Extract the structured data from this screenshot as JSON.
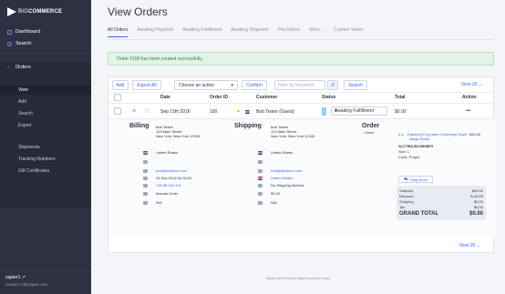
{
  "sidebar": {
    "logo_prefix": "BIG",
    "logo_suffix": "COMMERCE",
    "dashboard": "Dashboard",
    "search": "Search",
    "orders": "Orders",
    "sub_items": [
      "View",
      "Add",
      "Search",
      "Export",
      "Shipments",
      "Tracking Numbers",
      "Gift Certificates"
    ],
    "username": "zapier1",
    "email": "contact+1@zapier.com"
  },
  "header": {
    "title": "View Orders",
    "tabs": [
      "All Orders",
      "Awaiting Payment",
      "Awaiting Fulfillment",
      "Awaiting Shipment",
      "Pre-Orders",
      "More ⌄",
      "Custom Views"
    ]
  },
  "alert": "Order #100 has been created successfully.",
  "toolbar": {
    "add": "Add",
    "export_all": "Export All",
    "action_select": "Choose an action",
    "confirm": "Confirm",
    "filter_placeholder": "Filter by Keyword",
    "search": "Search",
    "view_count": "View 20 ⌄"
  },
  "table": {
    "headers": [
      "Date",
      "Order ID",
      "Customer",
      "Status",
      "Total",
      "Action"
    ],
    "row": {
      "date": "Sep 15th 2016",
      "order_id": "100",
      "customer": "Bob Tester (Guest)",
      "status": "Awaiting Fulfillment",
      "total": "$0.00",
      "action": "•••"
    }
  },
  "billing": {
    "title": "Billing",
    "name": "Bob Tester",
    "street": "123 Main Street",
    "city": "New York, New York 12345",
    "country": "United States",
    "email": "bob@techinch.com",
    "date": "15 Sep 2016 04:30:32",
    "ip": "135.95.242.102",
    "method": "Manual Order",
    "na": "N/A"
  },
  "shipping": {
    "title": "Shipping",
    "name": "Bob Tester",
    "street": "123 Main Street",
    "city": "New York, New York 12345",
    "country": "United States",
    "email": "bob@techinch.com",
    "country2": "United States",
    "method": "No Shipping Method",
    "cost": "$0.00",
    "na": "N/A"
  },
  "order": {
    "title": "Order",
    "items_count": "1 item",
    "qty": "1 x",
    "product": "[Sample] Fog Linen Chambray Towel - Beige Stripe",
    "sku": "SLCTBS-BC2B0BF3",
    "size": "Size: L",
    "color": "Color: Purple",
    "price": "$49.00",
    "ship_items": "Ship items",
    "subtotal_label": "Subtotal",
    "subtotal": "$49.00",
    "discount_label": "Discount",
    "discount": "$-49.00",
    "shipping_label": "Shipping",
    "shipping": "$0.00",
    "tax_label": "Tax",
    "tax": "$0.00",
    "grand_label": "GRAND TOTAL",
    "grand": "$0.00"
  },
  "footer": {
    "view_count": "View 20 ⌄",
    "made_with": "Made with ♥ by the BigCommerce team"
  },
  "colors": {
    "sidebar": "#2d3142",
    "accent": "#3c64f4",
    "alert_bg": "#e3f3e7"
  }
}
